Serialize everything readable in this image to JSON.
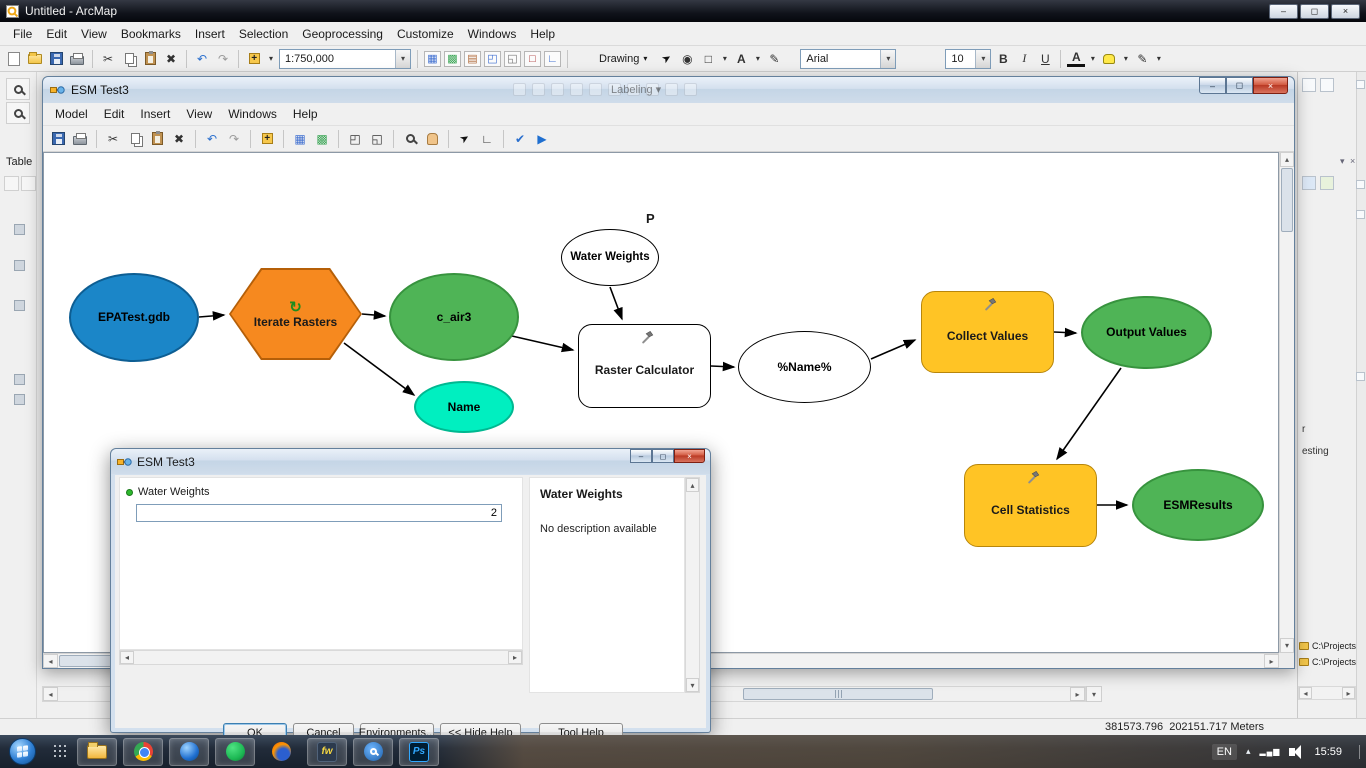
{
  "app": {
    "title": "Untitled - ArcMap",
    "menu": [
      "File",
      "Edit",
      "View",
      "Bookmarks",
      "Insert",
      "Selection",
      "Geoprocessing",
      "Customize",
      "Windows",
      "Help"
    ],
    "toolbar": {
      "scale": "1:750,000",
      "drawing": "Drawing",
      "font": "Arial",
      "font_size": "10",
      "bold": "B",
      "italic": "I",
      "underline": "U",
      "font_color": "A"
    },
    "ghost_label": "Labeling",
    "toc_title": "Table",
    "status_coordinates": "381573.796  202151.717 Meters",
    "catalog": {
      "fragment_top": "r",
      "fragment_mid": "esting",
      "tree_items": [
        "C:\\Projects\\Kildare Wind Strategy\\",
        "C:\\Projects\\SFAI Wind Strategies\\F"
      ]
    }
  },
  "model": {
    "title": "ESM Test3",
    "menu": [
      "Model",
      "Edit",
      "Insert",
      "View",
      "Windows",
      "Help"
    ],
    "nodes": {
      "epatest": "EPATest.gdb",
      "iterate": "Iterate Rasters",
      "c_air3": "c_air3",
      "name": "Name",
      "water_weights": "Water Weights",
      "param_badge": "P",
      "raster_calculator": "Raster Calculator",
      "pname": "%Name%",
      "collect_values": "Collect Values",
      "output_values": "Output Values",
      "cell_statistics": "Cell Statistics",
      "esm_results": "ESMResults"
    },
    "colors": {
      "input_blue": "#1b86c8",
      "iterator_orange": "#f6891f",
      "output_green": "#4fb456",
      "value_teal": "#00efc0",
      "tool_yellow": "#ffc425"
    }
  },
  "dialog": {
    "title": "ESM Test3",
    "param_label": "Water Weights",
    "param_value": "2",
    "help_title": "Water Weights",
    "help_text": "No description available",
    "buttons": {
      "ok": "OK",
      "cancel": "Cancel",
      "environments": "Environments...",
      "hide_help": "<< Hide Help",
      "tool_help": "Tool Help"
    }
  },
  "taskbar": {
    "language": "EN",
    "time": "15:59",
    "fw": "fw",
    "ps": "Ps"
  },
  "icons": {
    "cut": "✂",
    "delete": "✖",
    "undo": "↶",
    "redo": "↷",
    "dropdown": "▾",
    "grid_blue": "▦",
    "grid_green": "▩",
    "extent_in": "◰",
    "extent_out": "◱",
    "connect": "∟",
    "validate": "✔",
    "run": "▶",
    "loop": "↻",
    "pointer": "➤",
    "up": "▴",
    "down": "▾",
    "left": "◂",
    "right": "▸",
    "minimize": "–",
    "maximize": "◻",
    "close": "×",
    "circle": "◉",
    "square": "□",
    "textbox": "▤",
    "pencil": "✎",
    "letter_a": "A",
    "plus": "+"
  }
}
